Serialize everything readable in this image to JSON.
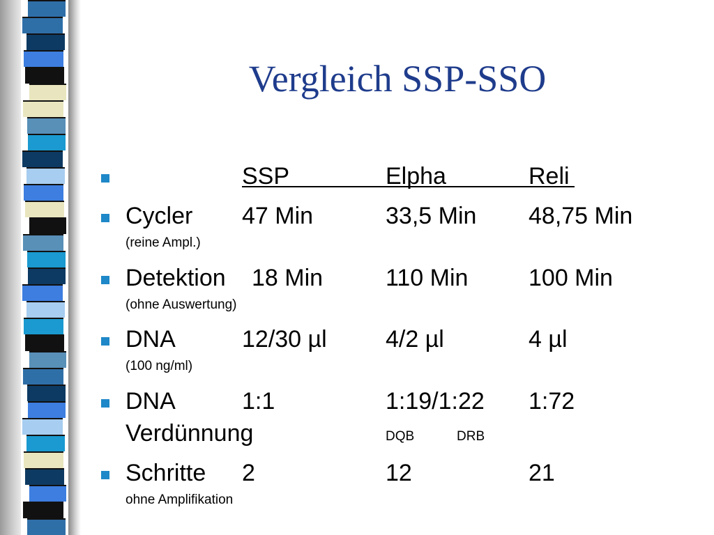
{
  "title": "Vergleich SSP-SSO",
  "colors": {
    "title": "#1f3c8c",
    "bullet": "#1f88c8",
    "stripes": [
      "#2f6fa8",
      "#0d3a63",
      "#3d7ee0",
      "#111111",
      "#e9e6bf",
      "#5890b8",
      "#1a9ad0",
      "#a7cdf0"
    ]
  },
  "header": {
    "col1": "SSP",
    "col2": "Elpha",
    "col3": "Reli"
  },
  "rows": [
    {
      "label": "Cycler",
      "note": "(reine Ampl.)",
      "v1": "47 Min",
      "v2": "33,5 Min",
      "v3": "48,75 Min"
    },
    {
      "label": "Detektion",
      "note": "(ohne Auswertung)",
      "v1": "18 Min",
      "v2": "110 Min",
      "v3": "100 Min"
    },
    {
      "label": "DNA",
      "note": "(100 ng/ml)",
      "v1": "12/30 µl",
      "v2": "4/2 µl",
      "v3": "4 µl"
    },
    {
      "label": "DNA",
      "label2": "Verdünnung",
      "v1": "1:1",
      "v2": "1:19/1:22",
      "v3": "1:72",
      "sub1": "DQB",
      "sub2": "DRB"
    },
    {
      "label": "Schritte",
      "note": "ohne Amplifikation",
      "v1": "2",
      "v2": "12",
      "v3": "21"
    }
  ]
}
